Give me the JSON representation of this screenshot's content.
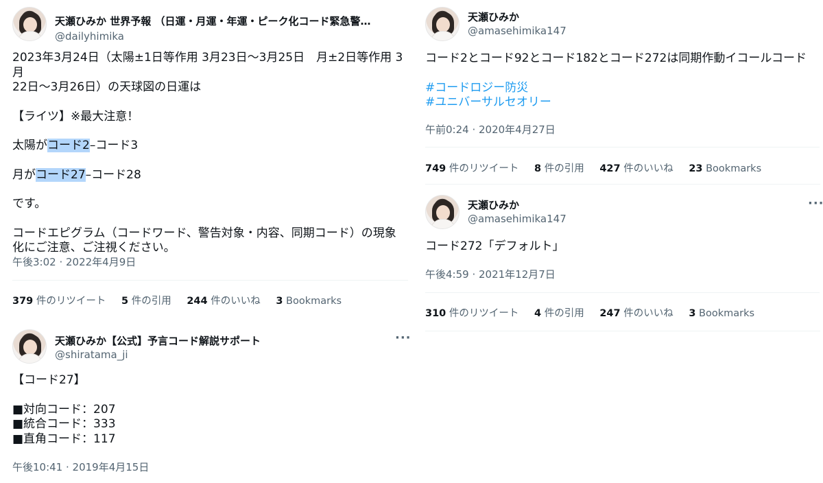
{
  "tweets": [
    {
      "name": "天瀬ひみか 世界予報 （日運・月運・年運・ピーク化コード緊急警…",
      "handle": "@dailyhimika",
      "line1": "2023年3月24日（太陽±1日等作用 3月23日〜3月25日　月±2日等作用 3月",
      "line2": "22日〜3月26日）の天球図の日運は",
      "line3": "【ライツ】※最大注意！",
      "line4_pre": "太陽が",
      "line4_hl": "コード2",
      "line4_post": "–コード3",
      "line5_pre": "月が",
      "line5_hl": "コード27",
      "line5_post": "–コード28",
      "line6": "です。",
      "line7": "コードエピグラム（コードワード、警告対象・内容、同期コード）の現象",
      "line8": "化にご注意、ご注視ください。",
      "time": "午後3:02 · 2022年4月9日",
      "retweets": "379",
      "retweets_label": "件のリツイート",
      "quotes": "5",
      "quotes_label": "件の引用",
      "likes": "244",
      "likes_label": "件のいいね",
      "bookmarks": "3",
      "bookmarks_label": "Bookmarks"
    },
    {
      "name": "天瀬ひみか【公式】予言コード解説サポート",
      "handle": "@shiratama_ji",
      "line1": "【コード27】",
      "line2": "■対向コード：207",
      "line3": "■統合コード：333",
      "line4": "■直角コード：117",
      "time": "午後10:41 · 2019年4月15日"
    },
    {
      "name": "天瀬ひみか",
      "handle": "@amasehimika147",
      "line1": "コード2とコード92とコード182とコード272は同期作動イコールコード",
      "tag1": "#コードロジー防災",
      "tag2": "#ユニバーサルセオリー",
      "time": "午前0:24 · 2020年4月27日",
      "retweets": "749",
      "retweets_label": "件のリツイート",
      "quotes": "8",
      "quotes_label": "件の引用",
      "likes": "427",
      "likes_label": "件のいいね",
      "bookmarks": "23",
      "bookmarks_label": "Bookmarks"
    },
    {
      "name": "天瀬ひみか",
      "handle": "@amasehimika147",
      "line1": "コード272「デフォルト」",
      "time": "午後4:59 · 2021年12月7日",
      "retweets": "310",
      "retweets_label": "件のリツイート",
      "quotes": "4",
      "quotes_label": "件の引用",
      "likes": "247",
      "likes_label": "件のいいね",
      "bookmarks": "3",
      "bookmarks_label": "Bookmarks"
    }
  ],
  "more_icon": "···",
  "colors": {
    "link": "#1d9bf0",
    "highlight": "#b3d6fb",
    "muted": "#536471"
  }
}
